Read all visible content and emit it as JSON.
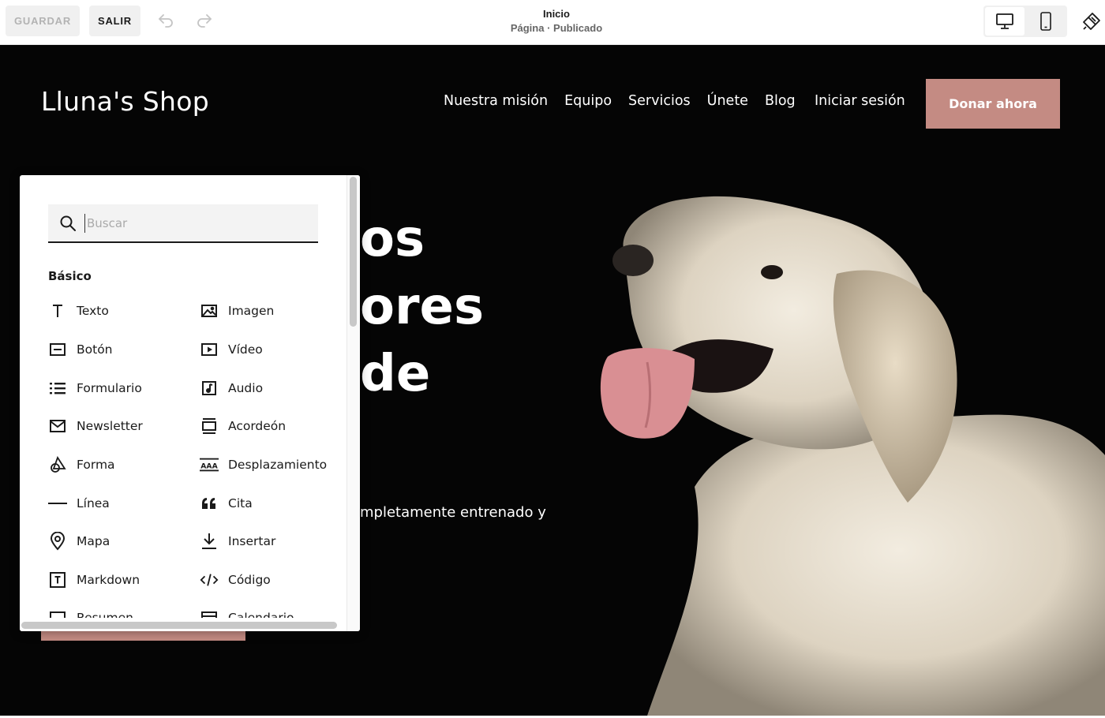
{
  "toolbar": {
    "save_label": "GUARDAR",
    "exit_label": "SALIR",
    "page_title": "Inicio",
    "page_status": "Página · Publicado"
  },
  "site": {
    "logo": "Lluna's Shop",
    "nav": [
      "Nuestra misión",
      "Equipo",
      "Servicios",
      "Únete",
      "Blog"
    ],
    "login": "Iniciar sesión",
    "donate": "Donar ahora",
    "hero_lines": [
      "os",
      "ores",
      "de"
    ],
    "hero_body": "mpletamente entrenado y",
    "accent_color": "#c48b83"
  },
  "panel": {
    "search_placeholder": "Buscar",
    "section_title": "Básico",
    "items_left": [
      {
        "label": "Texto",
        "icon": "text-icon"
      },
      {
        "label": "Botón",
        "icon": "button-icon"
      },
      {
        "label": "Formulario",
        "icon": "form-icon"
      },
      {
        "label": "Newsletter",
        "icon": "newsletter-icon"
      },
      {
        "label": "Forma",
        "icon": "shape-icon"
      },
      {
        "label": "Línea",
        "icon": "line-icon"
      },
      {
        "label": "Mapa",
        "icon": "map-pin-icon"
      },
      {
        "label": "Markdown",
        "icon": "markdown-icon"
      },
      {
        "label": "Resumen",
        "icon": "summary-icon"
      }
    ],
    "items_right": [
      {
        "label": "Imagen",
        "icon": "image-icon"
      },
      {
        "label": "Vídeo",
        "icon": "video-icon"
      },
      {
        "label": "Audio",
        "icon": "audio-icon"
      },
      {
        "label": "Acordeón",
        "icon": "accordion-icon"
      },
      {
        "label": "Desplazamiento",
        "icon": "scrolling-text-icon"
      },
      {
        "label": "Cita",
        "icon": "quote-icon"
      },
      {
        "label": "Insertar",
        "icon": "embed-icon"
      },
      {
        "label": "Código",
        "icon": "code-icon"
      },
      {
        "label": "Calendario",
        "icon": "calendar-icon"
      }
    ]
  }
}
